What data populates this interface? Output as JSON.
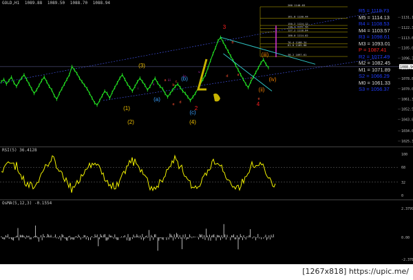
{
  "header": {
    "main": [
      "GOLD,H1",
      "1089.88",
      "1089.50",
      "1088.70",
      "1088.94"
    ],
    "rsi": "RSI(5) 36.4128",
    "osma": "OsMA(5,12,3) -0.1554"
  },
  "pivots": [
    {
      "label": "R5",
      "value": "1119.73",
      "color": "#1f3cff"
    },
    {
      "label": "M5",
      "value": "1114.13",
      "color": "#dddddd"
    },
    {
      "label": "R4",
      "value": "1108.53",
      "color": "#1f3cff"
    },
    {
      "label": "M4",
      "value": "1103.57",
      "color": "#dddddd"
    },
    {
      "label": "R3",
      "value": "1098.61",
      "color": "#1f3cff"
    },
    {
      "label": "M3",
      "value": "1093.01",
      "color": "#dddddd"
    },
    {
      "label": "P",
      "value": "1087.41",
      "color": "#ff2020"
    },
    {
      "label": "R2",
      "value": "1077.49",
      "color": "#1f3cff"
    },
    {
      "label": "M2",
      "value": "1082.45",
      "color": "#dddddd"
    },
    {
      "label": "M1",
      "value": "1071.89",
      "color": "#dddddd"
    },
    {
      "label": "S2",
      "value": "1066.29",
      "color": "#1f3cff"
    },
    {
      "label": "M0",
      "value": "1061.33",
      "color": "#dddddd"
    },
    {
      "label": "S3",
      "value": "1056.37",
      "color": "#1f3cff"
    }
  ],
  "fib_levels": [
    {
      "label": "200",
      "value": "1140.03"
    },
    {
      "label": "161.8",
      "value": "1130.44"
    },
    {
      "label": "150.2",
      "value": "1124.12"
    },
    {
      "label": "138.2",
      "value": "1121.56"
    },
    {
      "label": "127.2",
      "value": "1118.64"
    },
    {
      "label": "100.0",
      "value": "1114.02"
    },
    {
      "label": "76.4",
      "value": "1108.34"
    },
    {
      "label": "61.8",
      "value": "1105.80"
    },
    {
      "label": "38.2",
      "value": "1097.61"
    }
  ],
  "price_axis": [
    "1131.10",
    "1122.35",
    "1113.60",
    "1105.05",
    "1096.30",
    "1087.55",
    "1078.80",
    "1070.05",
    "1061.30",
    "1052.55",
    "1043.80",
    "1034.05",
    "1025.30"
  ],
  "current_price": "1088.94",
  "rsi_axis": [
    "100",
    "68",
    "32",
    "0"
  ],
  "osma_axis": [
    "2.3799",
    "0.00",
    "-2.3785"
  ],
  "wave_labels": [
    {
      "text": "(3)",
      "color": "#f0c000"
    },
    {
      "text": "(1)",
      "color": "#f0c000"
    },
    {
      "text": "(2)",
      "color": "#f0c000"
    },
    {
      "text": "(4)",
      "color": "#f0c000"
    },
    {
      "text": "(a)",
      "color": "#3aa0ff"
    },
    {
      "text": "(b)",
      "color": "#3aa0ff"
    },
    {
      "text": "(c)",
      "color": "#3aa0ff"
    },
    {
      "text": "3",
      "color": "#ff2020"
    },
    {
      "text": "4",
      "color": "#ff2020"
    },
    {
      "text": "2",
      "color": "#ff2020"
    },
    {
      "text": "(iii)",
      "color": "#f08000"
    },
    {
      "text": "(iv)",
      "color": "#f08000"
    },
    {
      "text": "(ii)",
      "color": "#f08000"
    }
  ],
  "chart_data": {
    "type": "line",
    "symbol": "GOLD,H1",
    "ohlc": {
      "open": 1089.88,
      "high": 1089.5,
      "low": 1088.7,
      "close": 1088.94
    },
    "ylim": [
      1025.3,
      1140.0
    ],
    "close_series": [
      1076,
      1078,
      1074,
      1077,
      1080,
      1075,
      1072,
      1076,
      1079,
      1082,
      1078,
      1074,
      1070,
      1066,
      1069,
      1073,
      1077,
      1080,
      1076,
      1072,
      1069,
      1064,
      1061,
      1066,
      1070,
      1074,
      1078,
      1082,
      1089,
      1086,
      1083,
      1079,
      1076,
      1073,
      1070,
      1066,
      1062,
      1058,
      1056,
      1060,
      1064,
      1068,
      1066,
      1062,
      1067,
      1071,
      1075,
      1079,
      1082,
      1078,
      1074,
      1071,
      1068,
      1072,
      1076,
      1079,
      1076,
      1073,
      1069,
      1072,
      1076,
      1079,
      1075,
      1072,
      1070,
      1066,
      1063,
      1066,
      1069,
      1072,
      1074,
      1071,
      1068,
      1066,
      1063,
      1060,
      1063,
      1066,
      1070,
      1074,
      1078,
      1082,
      1088,
      1094,
      1100,
      1105,
      1111,
      1114,
      1110,
      1106,
      1102,
      1098,
      1094,
      1090,
      1086,
      1082,
      1078,
      1074,
      1071,
      1076,
      1080,
      1084,
      1088,
      1092,
      1095,
      1091,
      1088
    ],
    "rsi_ylim": [
      0,
      100
    ],
    "rsi_levels": [
      68,
      32
    ],
    "osma_ylim": [
      -2.3785,
      2.3799
    ]
  }
}
